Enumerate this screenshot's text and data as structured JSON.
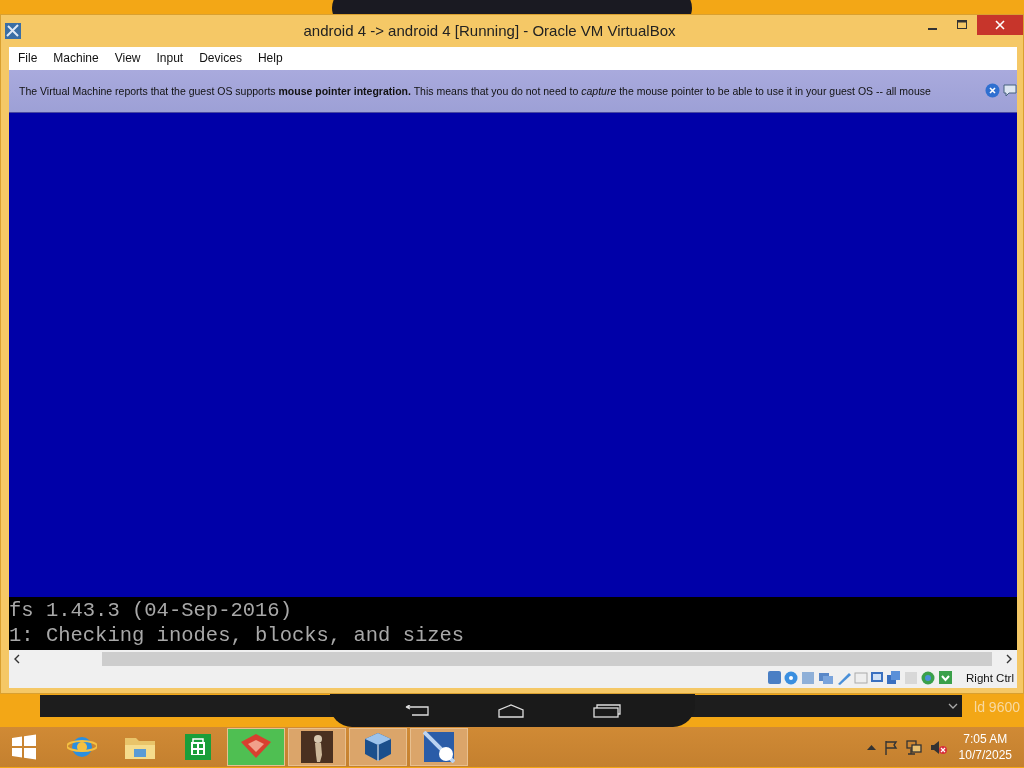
{
  "window": {
    "title": "android 4 -> android 4 [Running] - Oracle VM VirtualBox"
  },
  "menu": [
    "File",
    "Machine",
    "View",
    "Input",
    "Devices",
    "Help"
  ],
  "notice": {
    "text": "The Virtual Machine reports that the guest OS supports **mouse pointer integration.** This means that you do not need to *capture* the mouse pointer to be able to use it in your guest OS -- all mouse"
  },
  "console": {
    "lines": [
      "fs 1.43.3 (04-Sep-2016)",
      "1: Checking inodes, blocks, and sizes"
    ]
  },
  "status_bar": {
    "host_key": "Right Ctrl"
  },
  "desktop_text": "ld 9600",
  "taskbar": {
    "items": [
      {
        "kind": "browser",
        "running": false,
        "selected": false
      },
      {
        "kind": "folder",
        "running": false,
        "selected": false
      },
      {
        "kind": "store",
        "running": false,
        "selected": false
      },
      {
        "kind": "fox",
        "running": true,
        "selected": true
      },
      {
        "kind": "figure",
        "running": true,
        "selected": false
      },
      {
        "kind": "cube",
        "running": true,
        "selected": false
      },
      {
        "kind": "tile",
        "running": true,
        "selected": false
      }
    ],
    "clock": {
      "time": "7:05 AM",
      "date": "10/7/2025"
    }
  }
}
